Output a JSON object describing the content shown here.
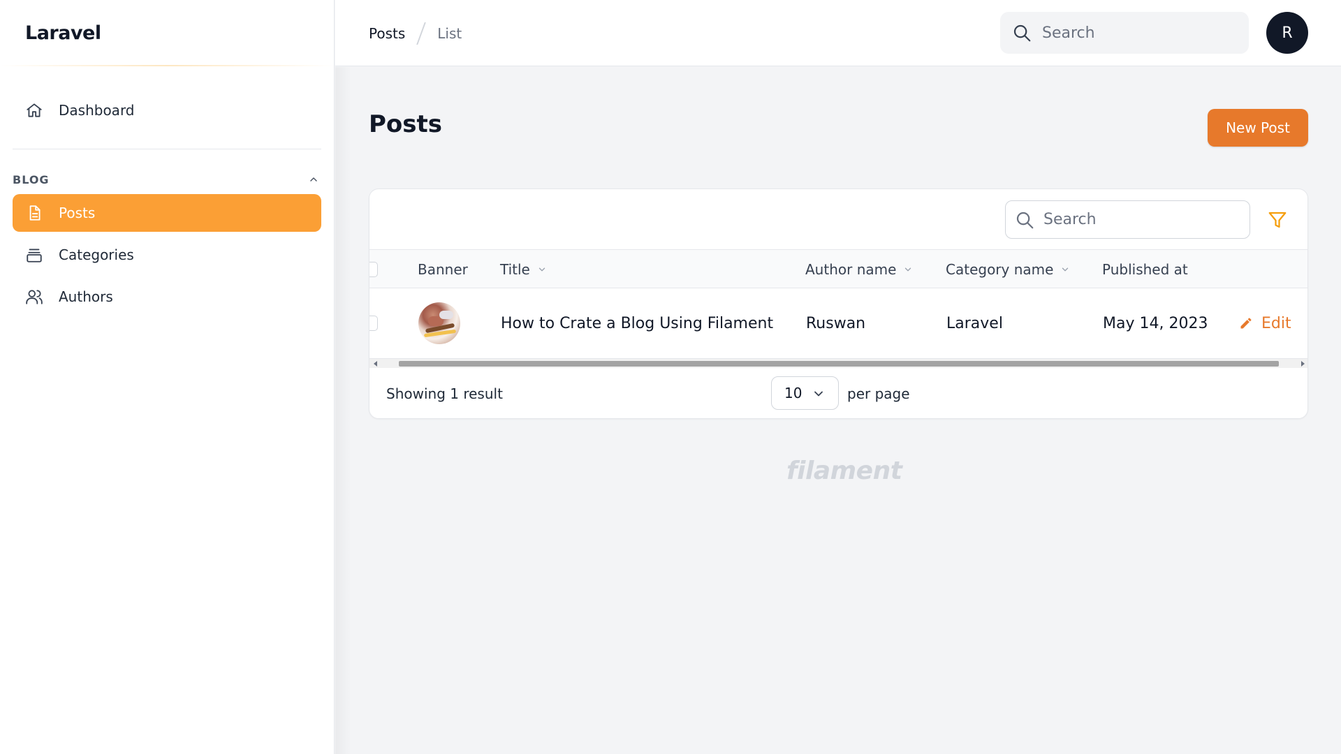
{
  "brand": {
    "name": "Laravel"
  },
  "sidebar": {
    "dashboard": {
      "label": "Dashboard",
      "icon": "home-icon"
    },
    "group": {
      "label": "BLOG",
      "icon": "chevron-up-icon"
    },
    "items": [
      {
        "label": "Posts",
        "icon": "document-icon",
        "active": true
      },
      {
        "label": "Categories",
        "icon": "archive-icon",
        "active": false
      },
      {
        "label": "Authors",
        "icon": "users-icon",
        "active": false
      }
    ]
  },
  "header": {
    "breadcrumbs": [
      "Posts",
      "List"
    ],
    "search": {
      "placeholder": "Search",
      "icon": "search-icon"
    },
    "avatar": {
      "initial": "R"
    }
  },
  "page": {
    "title": "Posts",
    "new_button_label": "New Post"
  },
  "table": {
    "search": {
      "placeholder": "Search"
    },
    "filter_icon": "funnel-icon",
    "columns": [
      "Banner",
      "Title",
      "Author name",
      "Category name",
      "Published at"
    ],
    "rows": [
      {
        "title": "How to Crate a Blog Using Filament",
        "author": "Ruswan",
        "category": "Laravel",
        "published_at": "May 14, 2023",
        "action_label": "Edit"
      }
    ],
    "footer": {
      "showing": "Showing 1 result",
      "per_page_value": "10",
      "per_page_label": "per page"
    }
  },
  "footer_brand": "filament",
  "colors": {
    "accent": "#fb9f35",
    "button": "#e7792b",
    "filter": "#f59e0b"
  }
}
